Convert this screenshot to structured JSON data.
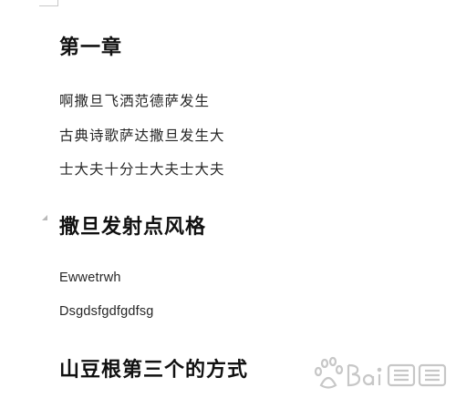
{
  "document": {
    "headings": [
      "第一章",
      "撒旦发射点风格",
      "山豆根第三个的方式"
    ],
    "chapter1_lines": [
      "啊撒旦飞洒范德萨发生",
      "古典诗歌萨达撒旦发生大",
      "士大夫十分士大夫士大夫"
    ],
    "section2_lines": [
      "Ewwetrwh",
      "Dsgdsfgdfgdfsg"
    ]
  }
}
